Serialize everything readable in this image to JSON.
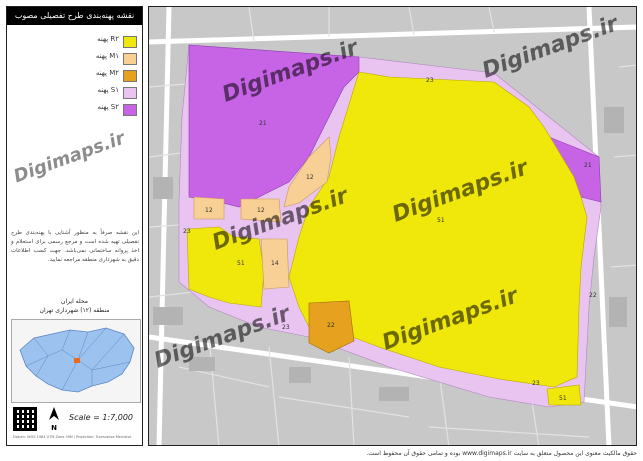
{
  "title": "نقشه پهنه‌بندی طرح تفصیلی مصوب",
  "legend": [
    {
      "code": "R۲ پهنه",
      "color": "#f0e80a"
    },
    {
      "code": "M۱ پهنه",
      "color": "#f8cf94"
    },
    {
      "code": "M۲ پهنه",
      "color": "#e6a21e"
    },
    {
      "code": "S۱ پهنه",
      "color": "#e9c4f0"
    },
    {
      "code": "S۲ پهنه",
      "color": "#c764e6"
    }
  ],
  "description": "این نقشه صرفاً به منظور آشنایی با پهنه‌بندی طرح تفصیلی تهیه شده است و مرجع رسمی برای استعلام و اخذ پروانه ساختمانی نمی‌باشد. جهت کسب اطلاعات دقیق به شهرداری منطقه مراجعه نمایید.",
  "region": {
    "neighborhood": "محله ایران",
    "district": "منطقه (۱۲) شهرداری تهران"
  },
  "scale": "Scale = 1:7,000",
  "north_label": "N",
  "footnote": "Datum: WGS 1984 UTM Zone 39N | Projection: Transverse Mercator",
  "credit": "حقوق مالکیت معنوی این محصول متعلق به سایت www.digimaps.ir بوده و تمامی حقوق آن محفوظ است.",
  "watermark": "Digimaps.ir",
  "watermark_short": "Digimaps.ir",
  "zones": {
    "r2_main": "51",
    "r2_west": "51",
    "r2_small": "51",
    "s2_north": "21",
    "s2_east": "21",
    "m1_north": "12",
    "m1_west_a": "12",
    "m1_west_b": "12",
    "m1_south": "14",
    "m2_south": "22",
    "s1_ne": "23",
    "s1_w": "23",
    "s1_s": "23",
    "s1_se": "23",
    "s1_e": "22"
  }
}
